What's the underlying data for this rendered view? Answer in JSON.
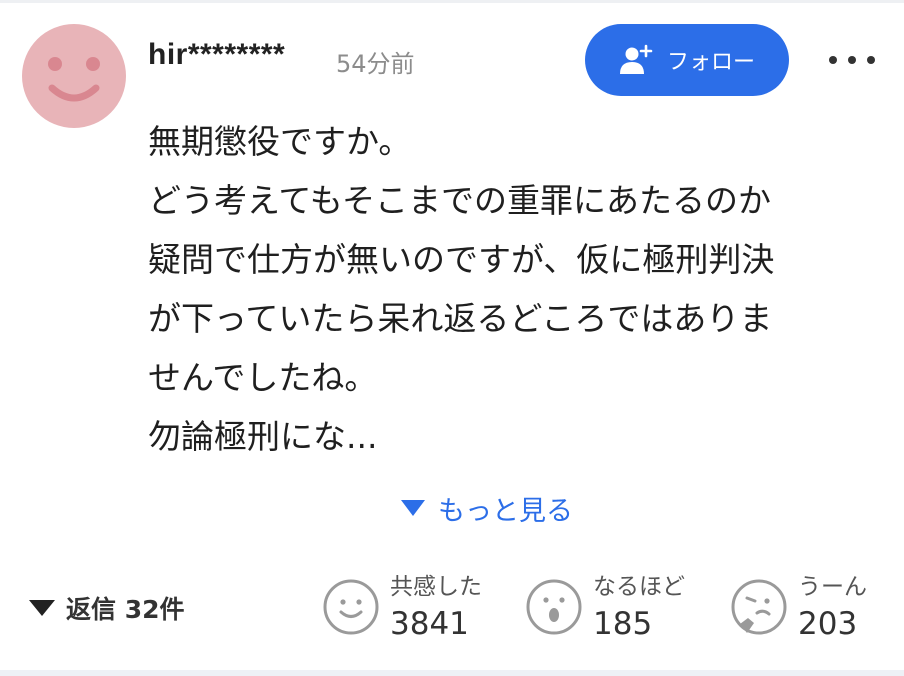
{
  "comment": {
    "username": "hir********",
    "timestamp": "54分前",
    "follow_label": "フォロー",
    "lines": [
      "無期懲役ですか。",
      "どう考えてもそこまでの重罪にあたるのか",
      "疑問で仕方が無いのですが、仮に極刑判決",
      "が下っていたら呆れ返るどころではありま",
      "せんでしたね。",
      "勿論極刑にな..."
    ],
    "see_more_label": "もっと見る",
    "replies_label": "返信 32件"
  },
  "reactions": [
    {
      "label": "共感した",
      "count": "3841",
      "icon": "smile-face-icon"
    },
    {
      "label": "なるほど",
      "count": "185",
      "icon": "surprised-face-icon"
    },
    {
      "label": "うーん",
      "count": "203",
      "icon": "thinking-face-icon"
    }
  ],
  "colors": {
    "accent": "#2c6ee8",
    "avatar_bg": "#e8b4b8",
    "avatar_face": "#d98790",
    "muted_text": "#8c8c8c"
  }
}
